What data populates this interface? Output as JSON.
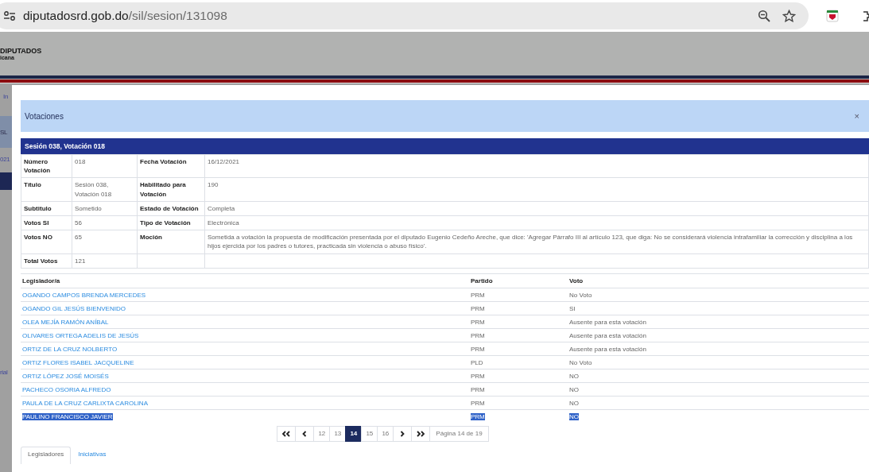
{
  "browser": {
    "url_host": "diputadosrd.gob.do",
    "url_path": "/sil/sesion/131098"
  },
  "site": {
    "logo_title": "DIPUTADOS",
    "logo_subtitle": "icana",
    "background_fragments": [
      "In",
      "SL",
      "021",
      "rial"
    ]
  },
  "modal": {
    "title": "Votaciones",
    "close": "×"
  },
  "session": {
    "heading": "Sesión 038, Votación 018",
    "details": [
      {
        "label": "Número Votación",
        "value": "018",
        "label2": "Fecha Votación",
        "value2": "16/12/2021"
      },
      {
        "label": "Título",
        "value": "Sesión 038, Votación 018",
        "label2": "Habilitado para Votación",
        "value2": "190"
      },
      {
        "label": "Subtitulo",
        "value": "Sometido",
        "label2": "Estado de Votación",
        "value2": "Completa"
      },
      {
        "label": "Votos SI",
        "value": "56",
        "label2": "Tipo de Votación",
        "value2": "Electrónica"
      },
      {
        "label": "Votos NO",
        "value": "65",
        "label2": "Moción",
        "value2": "Sometida a votación la propuesta de modificación presentada por el diputado Eugenio Cedeño Areche, que dice: 'Agregar Párrafo III al artículo 123, que diga: No se considerará violencia intrafamiliar la corrección y disciplina a los hijos ejercida por los padres o tutores, practicada sin violencia o abuso físico'."
      },
      {
        "label": "Total Votos",
        "value": "121"
      }
    ]
  },
  "votes": {
    "columns": [
      "Legislador/a",
      "Partido",
      "Voto"
    ],
    "rows": [
      {
        "name": "OGANDO CAMPOS BRENDA MERCEDES",
        "party": "PRM",
        "vote": "No Voto",
        "selected": false
      },
      {
        "name": "OGANDO GIL JESÚS BIENVENIDO",
        "party": "PRM",
        "vote": "SI",
        "selected": false
      },
      {
        "name": "OLEA MEJÍA RAMÓN ANÍBAL",
        "party": "PRM",
        "vote": "Ausente para esta votación",
        "selected": false
      },
      {
        "name": "OLIVARES ORTEGA ADELIS DE JESÚS",
        "party": "PRM",
        "vote": "Ausente para esta votación",
        "selected": false
      },
      {
        "name": "ORTIZ DE LA CRUZ NOLBERTO",
        "party": "PRM",
        "vote": "Ausente para esta votación",
        "selected": false
      },
      {
        "name": "ORTIZ FLORES ISABEL JACQUELINE",
        "party": "PLD",
        "vote": "No Voto",
        "selected": false
      },
      {
        "name": "ORTIZ LÓPEZ JOSÉ MOISÉS",
        "party": "PRM",
        "vote": "NO",
        "selected": false
      },
      {
        "name": "PACHECO OSORIA ALFREDO",
        "party": "PRM",
        "vote": "NO",
        "selected": false
      },
      {
        "name": "PAULA DE LA CRUZ CARLIXTA CAROLINA",
        "party": "PRM",
        "vote": "NO",
        "selected": false
      },
      {
        "name": "PAULINO FRANCISCO JAVIER",
        "party": "PRM",
        "vote": "NO",
        "selected": true
      }
    ]
  },
  "pagination": {
    "pages": [
      {
        "label": "12",
        "selected": false
      },
      {
        "label": "13",
        "selected": false
      },
      {
        "label": "14",
        "selected": true
      },
      {
        "label": "15",
        "selected": false
      },
      {
        "label": "16",
        "selected": false
      }
    ],
    "info": "Página 14 de 19"
  },
  "tabs": [
    {
      "label": "Legisladores",
      "selected": true
    },
    {
      "label": "Iniciativas",
      "selected": false
    }
  ]
}
